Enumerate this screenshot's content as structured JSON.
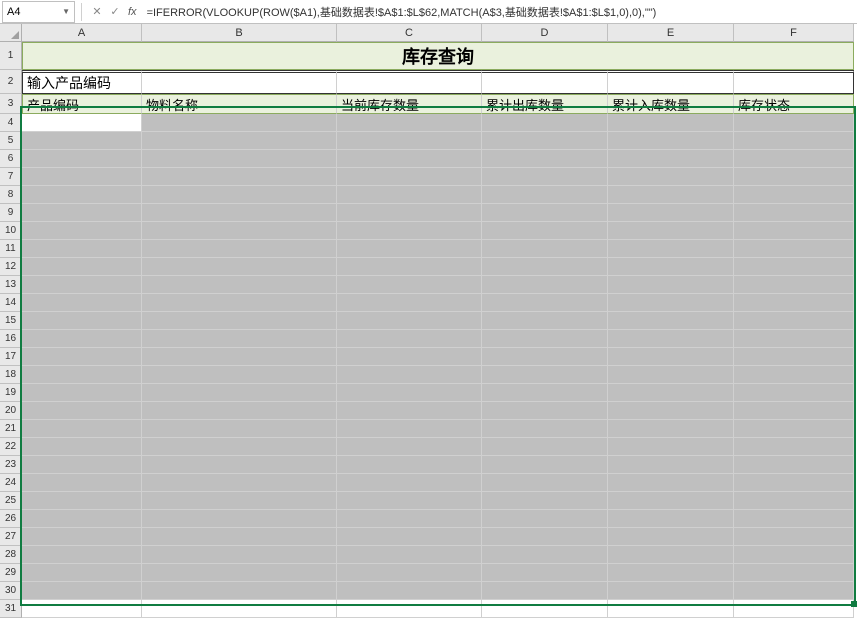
{
  "formula_bar": {
    "name_box": "A4",
    "formula": "=IFERROR(VLOOKUP(ROW($A1),基础数据表!$A$1:$L$62,MATCH(A$3,基础数据表!$A$1:$L$1,0),0),\"\")"
  },
  "columns": [
    "A",
    "B",
    "C",
    "D",
    "E",
    "F"
  ],
  "title": "库存查询",
  "input_label": "输入产品编码",
  "headers": {
    "colA": "产品编码",
    "colB": "物料名称",
    "colC": "当前库存数量",
    "colD": "累计出库数量",
    "colE": "累计入库数量",
    "colF": "库存状态"
  },
  "row_numbers": [
    "1",
    "2",
    "3",
    "4",
    "5",
    "6",
    "7",
    "8",
    "9",
    "10",
    "11",
    "12",
    "13",
    "14",
    "15",
    "16",
    "17",
    "18",
    "19",
    "20",
    "21",
    "22",
    "23",
    "24",
    "25",
    "26",
    "27",
    "28",
    "29",
    "30",
    "31"
  ]
}
